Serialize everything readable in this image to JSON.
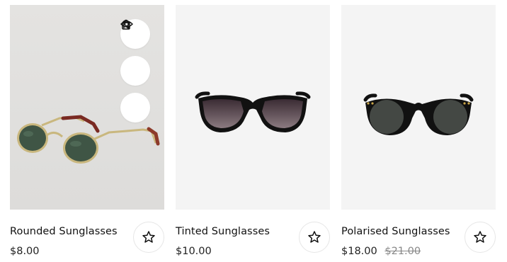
{
  "products": [
    {
      "name": "Rounded Sunglasses",
      "price": "$8.00",
      "actions": [
        "bag-icon",
        "compare-icon",
        "eye-icon"
      ],
      "image": "rounded-sunglasses-image"
    },
    {
      "name": "Tinted Sunglasses",
      "price": "$10.00",
      "image": "tinted-sunglasses-image"
    },
    {
      "name": "Polarised Sunglasses",
      "price": "$18.00",
      "old_price": "$21.00",
      "image": "polarised-sunglasses-image"
    }
  ],
  "wishlist_icon": "star-icon",
  "colors": {
    "image_bg": "#f4f4f4",
    "text": "#111111",
    "old_price": "#888888"
  }
}
